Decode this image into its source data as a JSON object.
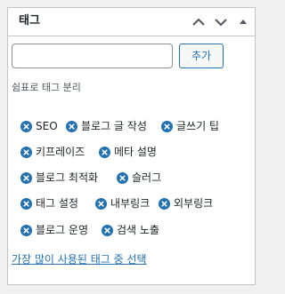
{
  "panel": {
    "title": "태그",
    "move_up_icon": "chevron-up-icon",
    "move_down_icon": "chevron-down-icon",
    "toggle_icon": "triangle-up-icon"
  },
  "tag_input": {
    "value": "",
    "placeholder": ""
  },
  "add_button": {
    "label": "추가"
  },
  "hint": "쉼표로 태그 분리",
  "tags": [
    "SEO",
    "블로그 글 작성",
    "글쓰기 팁",
    "키프레이즈",
    "메타 설명",
    "블로그 최적화",
    "슬러그",
    "태그 설정",
    "내부링크",
    "외부링크",
    "블로그 운영",
    "검색 노출"
  ],
  "remove_icon": "remove-circle-icon",
  "popular_link": "가장 많이 사용된 태그 중 선택",
  "colors": {
    "accent": "#2271b1",
    "remove_icon": "#2271b1",
    "border": "#c3c4c7"
  }
}
